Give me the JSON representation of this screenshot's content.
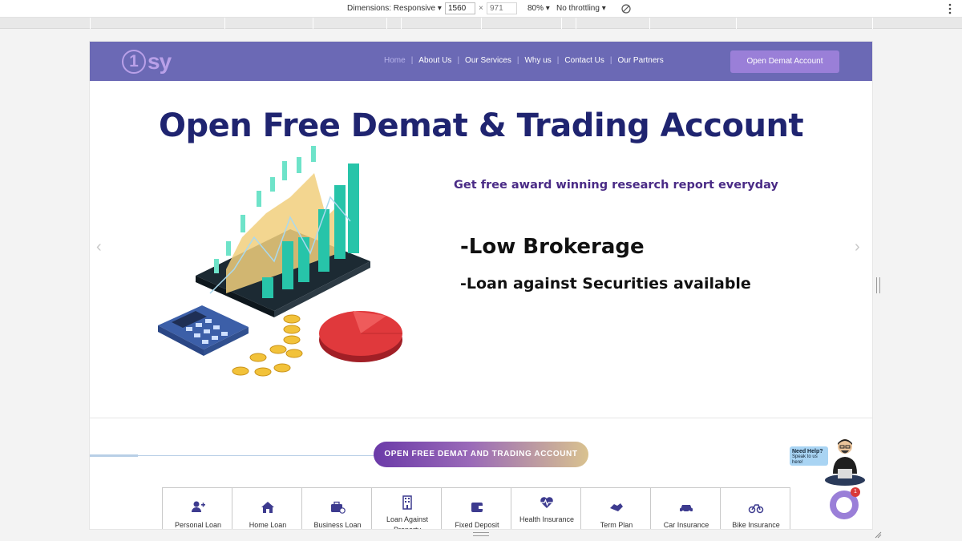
{
  "devtools": {
    "dimensions_label": "Dimensions: Responsive ▾",
    "width_value": "1560",
    "height_placeholder": "971",
    "zoom": "80% ▾",
    "throttling": "No throttling ▾",
    "rotate_icon": "rotate-icon",
    "menu_icon": "kebab-menu-icon"
  },
  "navbar": {
    "logo_one": "1",
    "logo_text": "sy",
    "items": [
      {
        "label": "Home",
        "active": true
      },
      {
        "label": "About Us"
      },
      {
        "label": "Our Services"
      },
      {
        "label": "Why us"
      },
      {
        "label": "Contact Us"
      },
      {
        "label": "Our Partners"
      }
    ],
    "separator": "|",
    "cta_label": "Open Demat Account",
    "colors": {
      "bar": "#6b69b5",
      "cta": "#9a7fd8"
    }
  },
  "banner": {
    "headline": "Open Free Demat & Trading Account",
    "subline": "Get free award winning research report everyday",
    "feature1": "-Low Brokerage",
    "feature2": "-Loan against Securities available",
    "prev_icon": "‹",
    "next_icon": "›"
  },
  "cta": {
    "label": "OPEN FREE DEMAT AND TRADING ACCOUNT"
  },
  "services": [
    {
      "label": "Personal Loan",
      "icon": "user-plus-icon"
    },
    {
      "label": "Home Loan",
      "icon": "home-icon"
    },
    {
      "label": "Business Loan",
      "icon": "briefcase-icon"
    },
    {
      "label": "Loan Against Property",
      "icon": "building-icon"
    },
    {
      "label": "Fixed Deposit",
      "icon": "wallet-icon"
    },
    {
      "label": "Health Insurance",
      "icon": "heartbeat-icon"
    },
    {
      "label": "Term Plan",
      "icon": "handshake-icon"
    },
    {
      "label": "Car Insurance",
      "icon": "car-icon"
    },
    {
      "label": "Bike Insurance",
      "icon": "bicycle-icon"
    }
  ],
  "chat": {
    "help_title": "Need Help?",
    "help_sub": "Speak to us here!",
    "badge": "1"
  }
}
